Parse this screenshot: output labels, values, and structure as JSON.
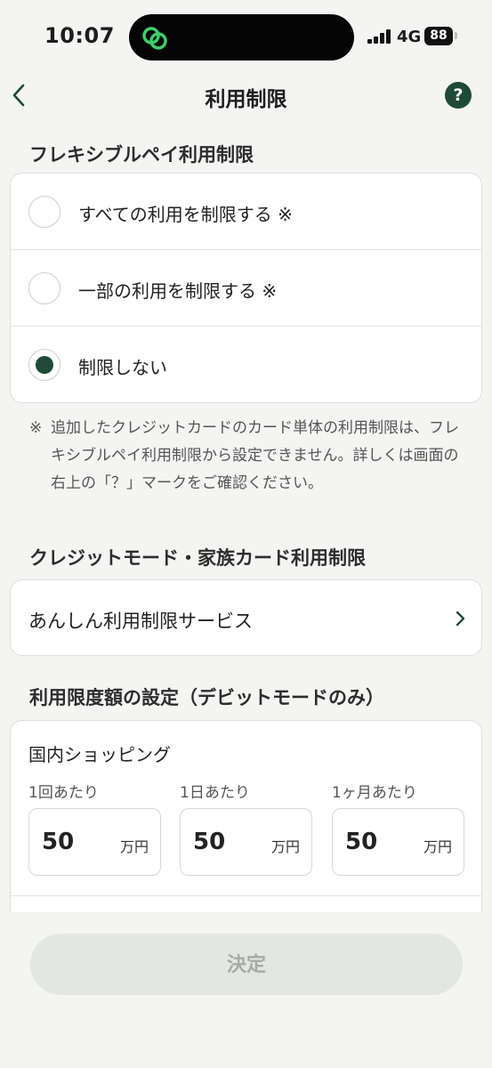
{
  "status_bar": {
    "time": "10:07",
    "network": "4G",
    "battery": "88",
    "island_icon": "app-link-icon"
  },
  "nav": {
    "title": "利用制限",
    "back_icon": "back-chevron-icon",
    "help_label": "?"
  },
  "flexible_pay": {
    "section_title": "フレキシブルペイ利用制限",
    "options": [
      {
        "label": "すべての利用を制限する ※",
        "selected": false
      },
      {
        "label": "一部の利用を制限する ※",
        "selected": false
      },
      {
        "label": "制限しない",
        "selected": true
      }
    ],
    "note_mark": "※",
    "note_text": "追加したクレジットカードのカード単体の利用制限は、フレキシブルペイ利用制限から設定できません。詳しくは画面の右上の「？」マークをご確認ください。"
  },
  "credit_family": {
    "section_title": "クレジットモード・家族カード利用制限",
    "link_label": "あんしん利用制限サービス"
  },
  "limit_settings": {
    "section_title": "利用限度額の設定（デビットモードのみ）",
    "category": "国内ショッピング",
    "columns": [
      {
        "label": "1回あたり",
        "value": "50",
        "unit": "万円"
      },
      {
        "label": "1日あたり",
        "value": "50",
        "unit": "万円"
      },
      {
        "label": "1ヶ月あたり",
        "value": "50",
        "unit": "万円"
      }
    ]
  },
  "footer": {
    "submit_label": "決定"
  },
  "colors": {
    "accent": "#1e4a37",
    "background": "#f4f4f3",
    "disabled_button": "#e2e7e4"
  }
}
